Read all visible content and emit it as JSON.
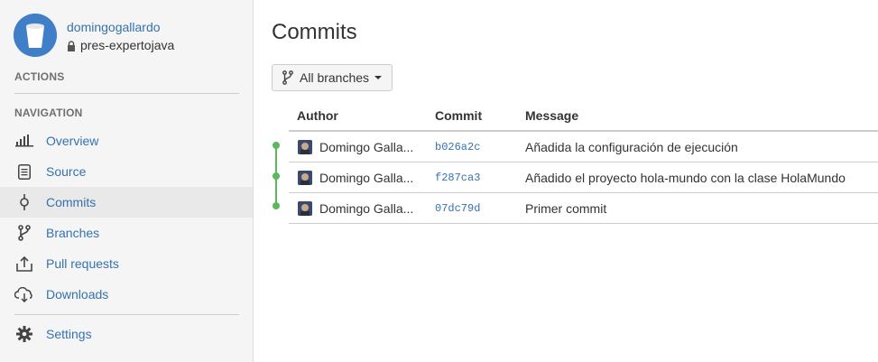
{
  "repo": {
    "owner": "domingogallardo",
    "name": "pres-expertojava"
  },
  "sidebar": {
    "actions_label": "ACTIONS",
    "navigation_label": "NAVIGATION",
    "items": [
      {
        "label": "Overview",
        "icon": "overview-bars-icon"
      },
      {
        "label": "Source",
        "icon": "source-file-icon"
      },
      {
        "label": "Commits",
        "icon": "commit-icon",
        "active": true
      },
      {
        "label": "Branches",
        "icon": "branch-icon"
      },
      {
        "label": "Pull requests",
        "icon": "pull-request-icon"
      },
      {
        "label": "Downloads",
        "icon": "cloud-download-icon"
      }
    ],
    "settings": {
      "label": "Settings",
      "icon": "gear-icon"
    }
  },
  "main": {
    "title": "Commits",
    "branch_filter": "All branches",
    "columns": {
      "author": "Author",
      "commit": "Commit",
      "message": "Message"
    },
    "commits": [
      {
        "author": "Domingo Galla...",
        "hash": "b026a2c",
        "message": "Añadida la configuración de ejecución"
      },
      {
        "author": "Domingo Galla...",
        "hash": "f287ca3",
        "message": "Añadido el proyecto hola-mundo con la clase HolaMundo"
      },
      {
        "author": "Domingo Galla...",
        "hash": "07dc79d",
        "message": "Primer commit"
      }
    ]
  },
  "colors": {
    "link": "#3572b0",
    "graph": "#5cb85c",
    "sidebar_bg": "#f5f5f5",
    "active_bg": "#e9e9e9"
  }
}
